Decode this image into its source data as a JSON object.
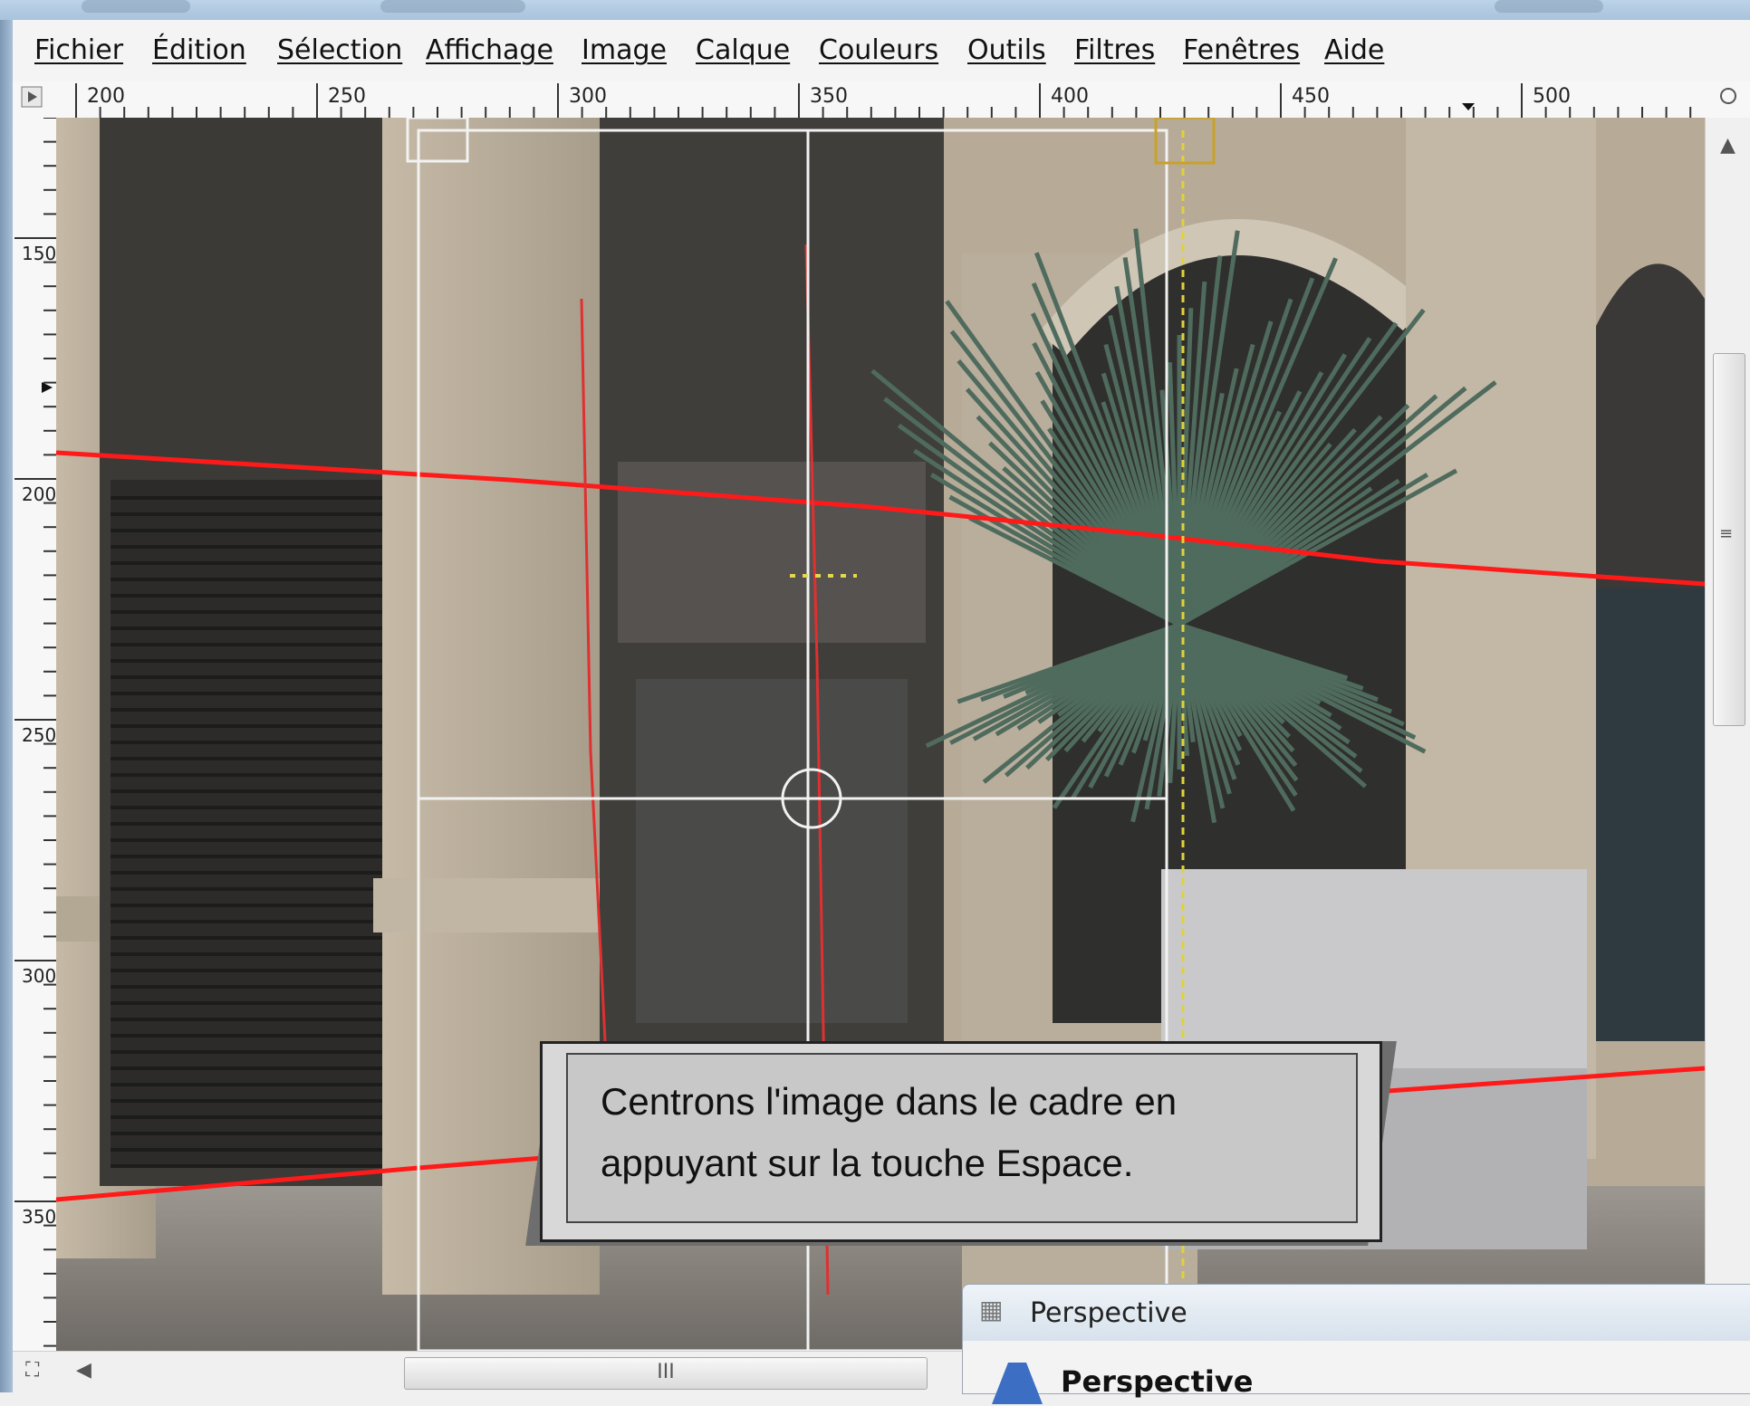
{
  "menu": {
    "items": [
      {
        "label": "Fichier"
      },
      {
        "label": "Édition"
      },
      {
        "label": "Sélection"
      },
      {
        "label": "Affichage"
      },
      {
        "label": "Image"
      },
      {
        "label": "Calque"
      },
      {
        "label": "Couleurs"
      },
      {
        "label": "Outils"
      },
      {
        "label": "Filtres"
      },
      {
        "label": "Fenêtres"
      },
      {
        "label": "Aide"
      }
    ]
  },
  "ruler": {
    "horizontal": [
      "200",
      "250",
      "300",
      "350",
      "400",
      "450",
      "500"
    ],
    "vertical": [
      "150",
      "200",
      "250",
      "300",
      "350"
    ]
  },
  "callout": {
    "line1": "Centrons l'image dans le cadre en",
    "line2": "appuyant sur la touche Espace."
  },
  "dialog": {
    "window_title": "Perspective",
    "heading": "Perspective"
  },
  "scrollbar": {
    "grip": "III"
  },
  "colors": {
    "guide_red": "#ff1a1a",
    "frame_white": "#f2f2f2",
    "handle_gold": "#c9a227"
  }
}
